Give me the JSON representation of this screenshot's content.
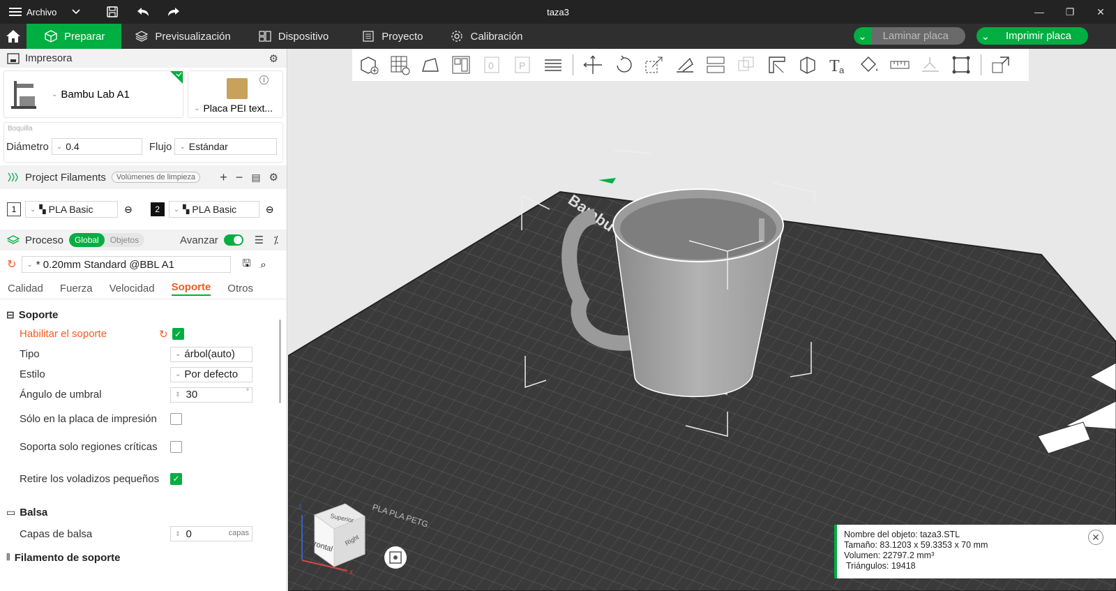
{
  "titlebar": {
    "menu_label": "Archivo",
    "window_title": "taza3"
  },
  "nav": {
    "tabs": [
      {
        "label": "Preparar"
      },
      {
        "label": "Previsualización"
      },
      {
        "label": "Dispositivo"
      },
      {
        "label": "Proyecto"
      },
      {
        "label": "Calibración"
      }
    ],
    "slice_label": "Laminar placa",
    "print_label": "Imprimir placa"
  },
  "printer": {
    "section_title": "Impresora",
    "printer_name": "Bambu Lab A1",
    "plate_name": "Placa PEI text...",
    "nozzle_label": "Boquilla",
    "diameter_label": "Diámetro",
    "diameter_value": "0.4",
    "flow_label": "Flujo",
    "flow_value": "Estándar"
  },
  "filaments": {
    "section_title": "Project Filaments",
    "flush_button": "Volúmenes de limpieza",
    "items": [
      {
        "index": "1",
        "name": "PLA Basic"
      },
      {
        "index": "2",
        "name": "PLA Basic"
      }
    ]
  },
  "process": {
    "section_title": "Proceso",
    "toggle_global": "Global",
    "toggle_objects": "Objetos",
    "advanced_label": "Avanzar",
    "profile": "* 0.20mm Standard @BBL A1",
    "tabs": [
      "Calidad",
      "Fuerza",
      "Velocidad",
      "Soporte",
      "Otros"
    ],
    "active_tab": "Soporte"
  },
  "support": {
    "group_title": "Soporte",
    "enable_label": "Habilitar el soporte",
    "type_label": "Tipo",
    "type_value": "árbol(auto)",
    "style_label": "Estilo",
    "style_value": "Por defecto",
    "angle_label": "Ángulo de umbral",
    "angle_value": "30",
    "angle_unit": "°",
    "plate_only_label": "Sólo en la placa de impresión",
    "critical_label": "Soporta solo regiones críticas",
    "remove_small_label": "Retire los voladizos pequeños",
    "raft_group_title": "Balsa",
    "raft_layers_label": "Capas de balsa",
    "raft_layers_value": "0",
    "raft_layers_unit": "capas",
    "filament_group_title": "Filamento de soporte"
  },
  "viewport": {
    "plate_text": "Bambu Textured PEI Plate",
    "plate_strip_text": "PLA PLA PETG",
    "cube_top": "Superior",
    "cube_front": "Frontal",
    "cube_right": "Right",
    "axis_x": "x",
    "axis_z": "z"
  },
  "object_info": {
    "name_line": "Nombre del objeto: taza3.STL",
    "size_line": "Tamaño: 83.1203 x 59.3353 x 70 mm",
    "volume_line": "Volumen: 22797.2 mm³",
    "triangles_line": "Triángulos: 19418"
  }
}
